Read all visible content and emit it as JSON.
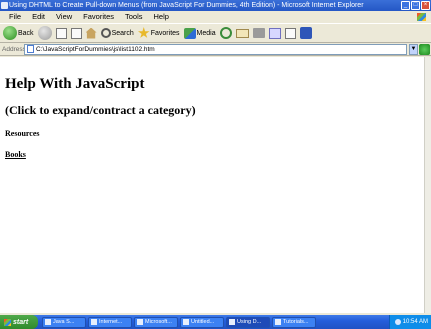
{
  "window": {
    "title": "Using DHTML to Create Pull-down Menus (from JavaScript For Dummies, 4th Edition) - Microsoft Internet Explorer"
  },
  "menu": {
    "items": [
      "File",
      "Edit",
      "View",
      "Favorites",
      "Tools",
      "Help"
    ]
  },
  "toolbar": {
    "back_label": "Back",
    "search_label": "Search",
    "favorites_label": "Favorites",
    "media_label": "Media"
  },
  "address": {
    "label": "Address",
    "value": "C:\\JavaScriptForDummies\\js\\list1102.htm"
  },
  "page": {
    "heading": "Help With JavaScript",
    "subtitle": "(Click to expand/contract a category)",
    "resources": "Resources",
    "books": "Books"
  },
  "taskbar": {
    "start_label": "start",
    "items": [
      "Java S...",
      "Internet...",
      "Microsoft...",
      "Untitled...",
      "Using D...",
      "Tutorials..."
    ],
    "active_index": 4,
    "clock": "10:54 AM"
  },
  "colors": {
    "titlebar": "#2457c5",
    "taskbar": "#245edb",
    "start": "#2f8a2b"
  }
}
